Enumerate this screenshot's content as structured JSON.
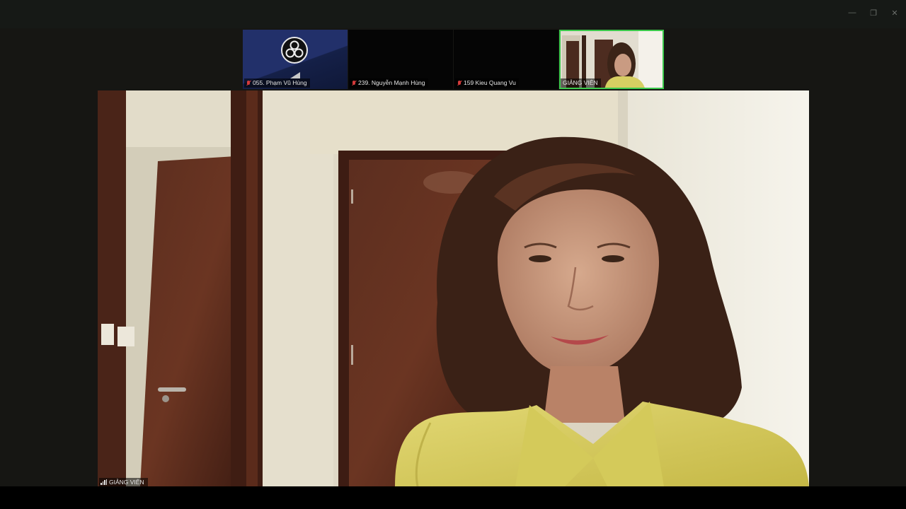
{
  "window": {
    "controls": [
      {
        "name": "minimize-button",
        "glyph": "—"
      },
      {
        "name": "restore-button",
        "glyph": "❐"
      },
      {
        "name": "close-button",
        "glyph": "✕"
      }
    ]
  },
  "participants": [
    {
      "label": "055. Phạm Vũ Hùng",
      "muted": true,
      "video": "obs-logo"
    },
    {
      "label": "239. Nguyễn Mạnh Hùng",
      "muted": true,
      "video": "off"
    },
    {
      "label": "159 Kieu Quang Vu",
      "muted": true,
      "video": "off"
    },
    {
      "label": "GIẢNG VIÊN",
      "muted": false,
      "video": "on",
      "active_speaker": true
    }
  ],
  "main_video": {
    "label": "GIẢNG VIÊN",
    "icon": "signal-bars-icon"
  },
  "colors": {
    "active_border": "#3cc94c",
    "muted_icon": "#d43b3b",
    "background": "#161613"
  }
}
